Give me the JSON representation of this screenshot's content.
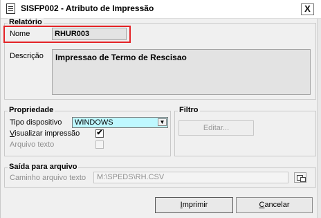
{
  "window": {
    "title": "SISFP002 - Atributo de Impressão",
    "close_label": "X"
  },
  "relatorio": {
    "legend": "Relatório",
    "nome_label": "Nome",
    "nome_value": "RHUR003",
    "descricao_label": "Descrição",
    "descricao_value": "Impressao de Termo de Rescisao"
  },
  "propriedade": {
    "legend": "Propriedade",
    "tipo_label": "Tipo dispositivo",
    "tipo_value": "WINDOWS",
    "visualizar_label": "Visualizar impressão",
    "visualizar_checked": true,
    "arquivo_label": "Arquivo texto",
    "arquivo_checked": false
  },
  "filtro": {
    "legend": "Filtro",
    "editar_label": "Editar..."
  },
  "saida": {
    "legend": "Saída para arquivo",
    "caminho_label": "Caminho arquivo texto",
    "caminho_value": "M:\\SPEDS\\RH.CSV"
  },
  "buttons": {
    "imprimir": "Imprimir",
    "cancelar": "Cancelar"
  },
  "colors": {
    "highlight": "#e42226",
    "dropdown_bg": "#bff8ff"
  }
}
